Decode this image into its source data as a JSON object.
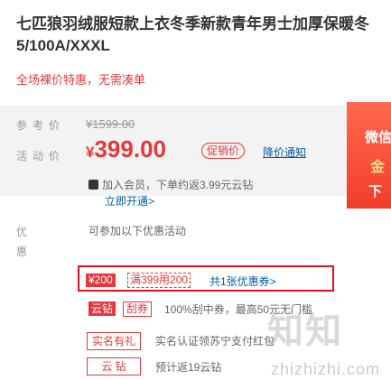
{
  "product": {
    "title_line1": "七匹狼羽绒服短款上衣冬季新款青年男士加厚保暖冬",
    "title_line2": "5/100A/XXXL",
    "promo_text": "全场裸价特惠，无需凑单"
  },
  "price": {
    "ref_label": "参考价",
    "ref_value": "¥1599.00",
    "act_label": "活动价",
    "currency": "¥",
    "act_value": "399.00",
    "promo_tag": "促销价",
    "notify_link": "降价通知"
  },
  "member": {
    "text": "加入会员，下单约返3.99元云钻",
    "link": "立即开通>"
  },
  "banner": {
    "line1": "微信",
    "line2": "金",
    "line3": "下"
  },
  "coupons": {
    "label_1": "优",
    "label_2": "惠",
    "hint": "可参加以下优惠活动",
    "coupon_value": "¥200",
    "coupon_rule": "满399用200",
    "coupon_link": "共1张优惠券>",
    "tag_yz": "云钻",
    "tag_gq": "刮券",
    "gq_text": "100%刮中券，最高50元无门槛",
    "row1_tag": "实名有礼",
    "row1_text": "实名认证领苏宁支付红包",
    "row2_tag": "云 钻",
    "row2_text": "预计返19云钻"
  },
  "watermark": {
    "logo": "知知",
    "url": "zhizhizhi.com"
  },
  "colors": {
    "accent": "#e4393c",
    "link": "#005ea7",
    "frame": "#e4101d"
  }
}
